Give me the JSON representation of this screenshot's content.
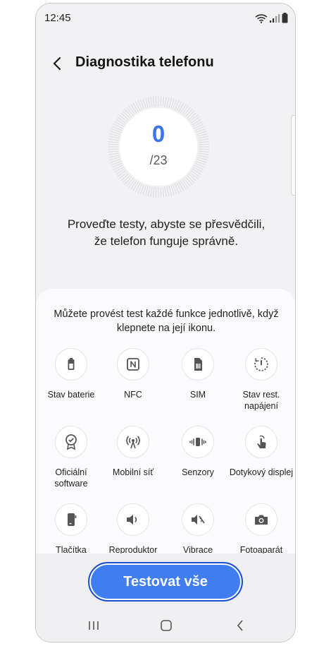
{
  "status_bar": {
    "time": "12:45"
  },
  "header": {
    "title": "Diagnostika telefonu"
  },
  "progress": {
    "count": "0",
    "total": "/23",
    "accent": "#3f74e8"
  },
  "description": "Proveďte testy, abyste se přesvědčili, že telefon funguje správně.",
  "card": {
    "hint": "Můžete provést test každé funkce jednotlivě, když klepnete na její ikonu.",
    "tests": [
      {
        "label": "Stav baterie",
        "icon": "battery-icon"
      },
      {
        "label": "NFC",
        "icon": "nfc-icon"
      },
      {
        "label": "SIM",
        "icon": "sim-icon"
      },
      {
        "label": "Stav rest. napájení",
        "icon": "restart-power-icon"
      },
      {
        "label": "Oficiální software",
        "icon": "certified-badge-icon"
      },
      {
        "label": "Mobilní síť",
        "icon": "signal-tower-icon"
      },
      {
        "label": "Senzory",
        "icon": "sensor-icon"
      },
      {
        "label": "Dotykový displej",
        "icon": "touch-icon"
      },
      {
        "label": "Tlačítka",
        "icon": "phone-buttons-icon"
      },
      {
        "label": "Reproduktor",
        "icon": "speaker-icon"
      },
      {
        "label": "Vibrace",
        "icon": "vibrate-icon"
      },
      {
        "label": "Fotoaparát",
        "icon": "camera-icon"
      }
    ]
  },
  "actions": {
    "test_all": "Testovat vše"
  }
}
